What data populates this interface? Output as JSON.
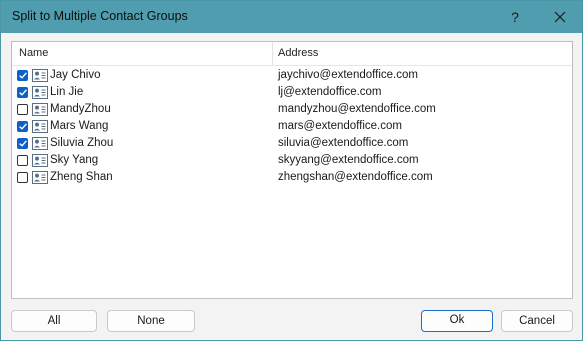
{
  "window": {
    "title": "Split to Multiple Contact Groups",
    "help_glyph": "?",
    "close_icon": "close-icon"
  },
  "list": {
    "columns": [
      "Name",
      "Address"
    ],
    "rows": [
      {
        "checked": true,
        "name": "Jay Chivo",
        "address": "jaychivo@extendoffice.com"
      },
      {
        "checked": true,
        "name": "Lin Jie",
        "address": "lj@extendoffice.com"
      },
      {
        "checked": false,
        "name": "MandyZhou",
        "address": "mandyzhou@extendoffice.com"
      },
      {
        "checked": true,
        "name": "Mars Wang",
        "address": "mars@extendoffice.com"
      },
      {
        "checked": true,
        "name": "Siluvia Zhou",
        "address": "siluvia@extendoffice.com"
      },
      {
        "checked": false,
        "name": "Sky Yang",
        "address": "skyyang@extendoffice.com"
      },
      {
        "checked": false,
        "name": "Zheng Shan",
        "address": "zhengshan@extendoffice.com"
      }
    ]
  },
  "buttons": {
    "all": "All",
    "none": "None",
    "ok": "Ok",
    "cancel": "Cancel"
  },
  "colors": {
    "titlebar": "#4f9daf",
    "checkbox_checked": "#0f5fc7",
    "ok_border": "#1a6fc7"
  }
}
